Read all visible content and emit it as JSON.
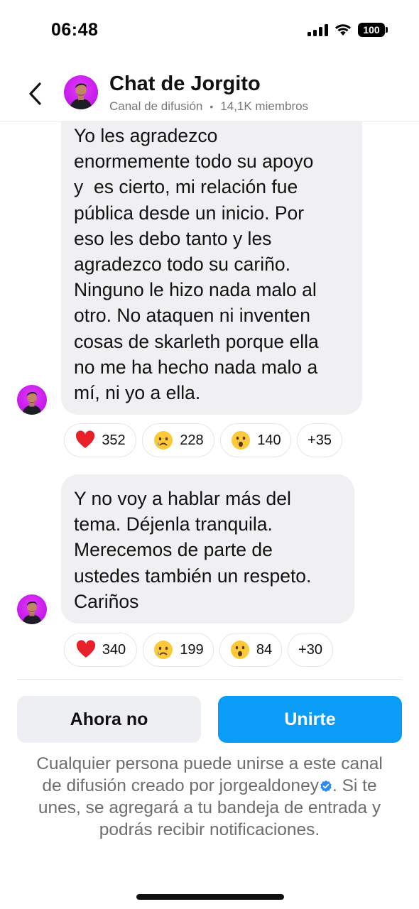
{
  "status_bar": {
    "time": "06:48",
    "battery": "100"
  },
  "header": {
    "title": "Chat de Jorgito",
    "subtitle": "Canal de difusión",
    "separator": "•",
    "members": "14,1K miembros"
  },
  "messages": [
    {
      "lines": [
        "Yo les agradezco",
        "enormemente todo su apoyo",
        "y  es cierto, mi relación fue",
        "pública desde un inicio. Por",
        "eso les debo tanto y les",
        "agradezco todo su cariño.",
        "Ninguno le hizo nada malo al",
        "otro. No ataquen ni inventen",
        "cosas de skarleth porque ella",
        "no me ha hecho nada malo a",
        "mí, ni yo a ella."
      ],
      "reactions": [
        {
          "emoji": "❤️",
          "icon": "red-heart",
          "count": "352"
        },
        {
          "emoji": "😢",
          "icon": "crying-face",
          "count": "228"
        },
        {
          "emoji": "😮",
          "icon": "surprised-face",
          "count": "140"
        }
      ],
      "more": "+35"
    },
    {
      "lines": [
        "Y no voy a hablar más del",
        "tema. Déjenla tranquila.",
        "Merecemos de parte de",
        "ustedes también un respeto.",
        "Cariños"
      ],
      "reactions": [
        {
          "emoji": "❤️",
          "icon": "red-heart",
          "count": "340"
        },
        {
          "emoji": "😢",
          "icon": "crying-face",
          "count": "199"
        },
        {
          "emoji": "😮",
          "icon": "surprised-face",
          "count": "84"
        }
      ],
      "more": "+30"
    }
  ],
  "actions": {
    "secondary": "Ahora no",
    "primary": "Unirte"
  },
  "disclaimer": {
    "line1": "Cualquier persona puede unirse a este canal",
    "line2_prefix": "de difusión creado por jorgealdoney",
    "line2_suffix": ". Si te",
    "line3": "unes, se agregará a tu bandeja de entrada y",
    "line4": "podrás recibir notificaciones."
  },
  "colors": {
    "primary_button": "#0a9cf6",
    "avatar_bg": "#c418e8",
    "bubble_bg": "#f0f0f3",
    "verified_badge": "#2b8cf0"
  }
}
